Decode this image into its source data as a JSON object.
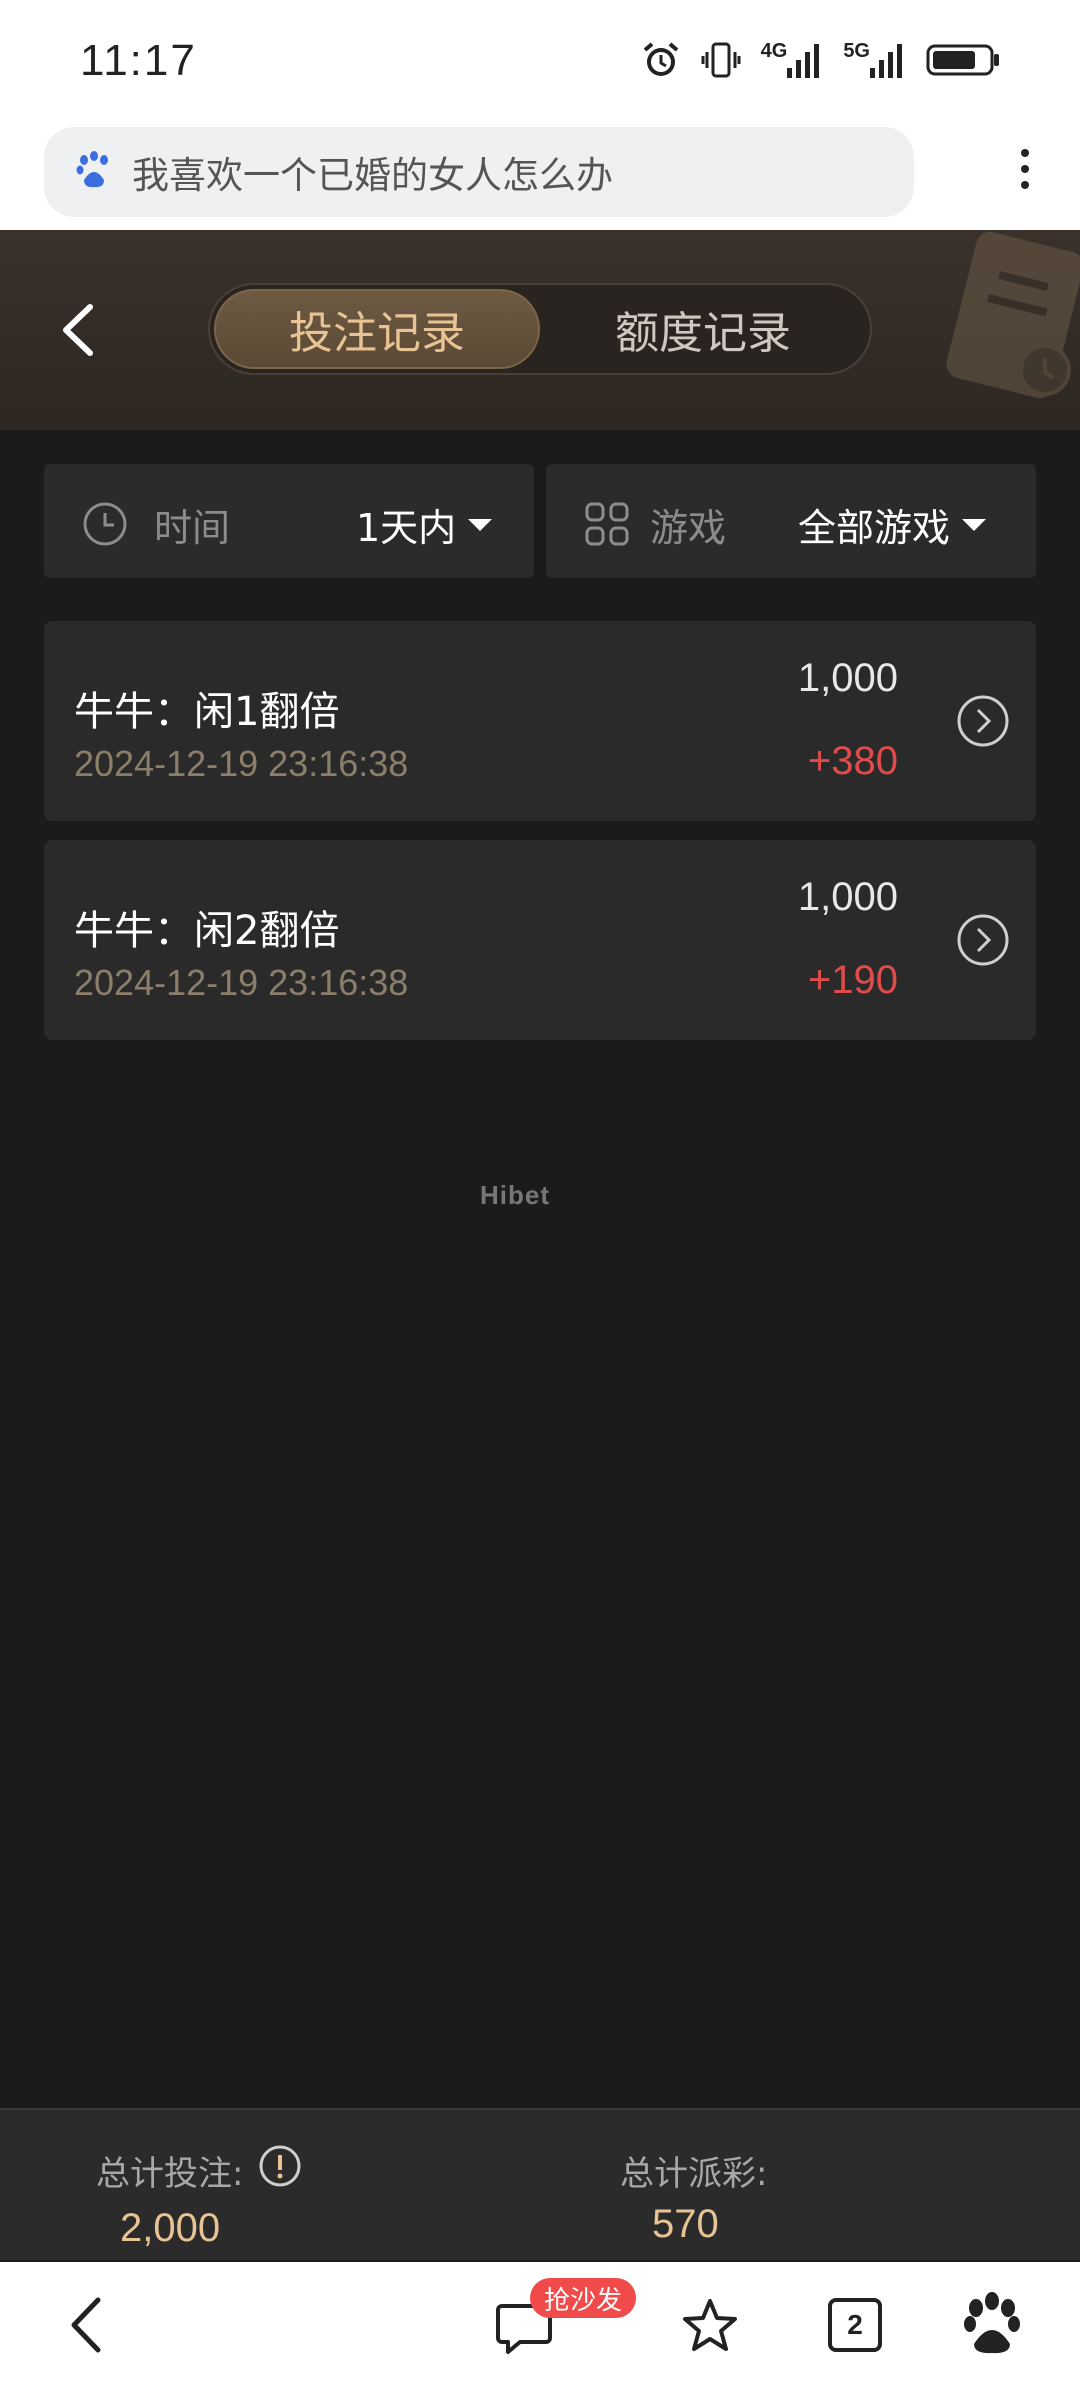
{
  "status_bar": {
    "time": "11:17",
    "network_1": "4G",
    "network_2": "5G",
    "icons": [
      "alarm-icon",
      "vibrate-icon",
      "signal-icon",
      "signal-icon",
      "battery-icon"
    ]
  },
  "browser": {
    "search_text": "我喜欢一个已婚的女人怎么办",
    "menu_icon": "more-vertical-icon"
  },
  "header": {
    "tabs": [
      {
        "label": "投注记录",
        "active": true
      },
      {
        "label": "额度记录",
        "active": false
      }
    ],
    "accent_color": "#e8c394"
  },
  "filters": {
    "time": {
      "label": "时间",
      "value": "1天内",
      "icon": "clock-icon"
    },
    "game": {
      "label": "游戏",
      "value": "全部游戏",
      "icon": "grid-icon"
    }
  },
  "records": [
    {
      "title": "牛牛：闲1翻倍",
      "time": "2024-12-19 23:16:38",
      "bet": "1,000",
      "win": "+380"
    },
    {
      "title": "牛牛：闲2翻倍",
      "time": "2024-12-19 23:16:38",
      "bet": "1,000",
      "win": "+190"
    }
  ],
  "watermark": "Hibet",
  "totals": {
    "bet_label": "总计投注:",
    "bet_value": "2,000",
    "payout_label": "总计派彩:",
    "payout_value": "570"
  },
  "bottom_nav": {
    "badge": "抢沙发",
    "tab_count": "2"
  }
}
